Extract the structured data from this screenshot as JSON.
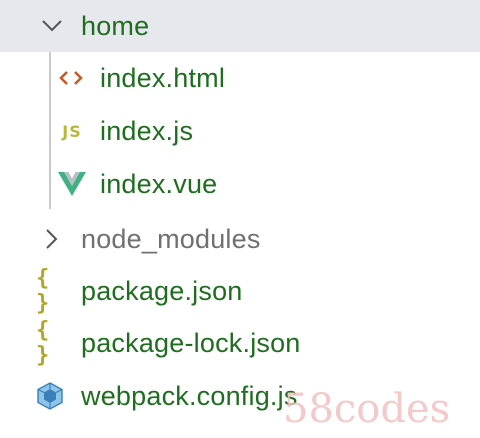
{
  "explorer": {
    "items": [
      {
        "label": "home",
        "type": "folder",
        "expanded": true,
        "icon": "chevron-down-icon",
        "selected": true
      },
      {
        "label": "index.html",
        "type": "file",
        "icon": "html-icon",
        "icon_color": "#c75a28"
      },
      {
        "label": "index.js",
        "type": "file",
        "icon": "js-icon",
        "icon_text": "JS",
        "icon_color": "#b9b83a"
      },
      {
        "label": "index.vue",
        "type": "file",
        "icon": "vue-icon",
        "icon_color": "#3fb27f"
      },
      {
        "label": "node_modules",
        "type": "folder",
        "expanded": false,
        "icon": "chevron-right-icon"
      },
      {
        "label": "package.json",
        "type": "file",
        "icon": "json-icon",
        "icon_text": "{ }",
        "icon_color": "#b0a62a"
      },
      {
        "label": "package-lock.json",
        "type": "file",
        "icon": "json-icon",
        "icon_text": "{ }",
        "icon_color": "#b0a62a"
      },
      {
        "label": "webpack.config.js",
        "type": "file",
        "icon": "webpack-icon",
        "icon_color": "#3a7fb5"
      }
    ]
  },
  "watermark": {
    "text": "58codes"
  },
  "colors": {
    "selected_row": "#e7e8ee",
    "label_green": "#1f6e1f",
    "label_gray": "#707070"
  }
}
